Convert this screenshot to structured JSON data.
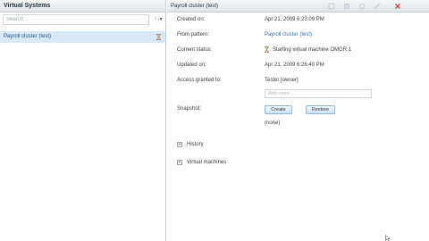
{
  "left_panel": {
    "title": "Virtual Systems",
    "search": {
      "placeholder": "Search...",
      "value": ""
    },
    "sort_label": "↑↓▾",
    "items": [
      {
        "label": "Payroll cluster (test)",
        "status_icon": "hourglass-icon"
      }
    ]
  },
  "detail": {
    "title": "Payroll cluster (test)",
    "rows": {
      "created_on": {
        "label": "Created on:",
        "value": "Apr 21, 2009 6:23:09 PM"
      },
      "from_pattern": {
        "label": "From pattern:",
        "value": "Payroll cluster (test)"
      },
      "current_status": {
        "label": "Current status:",
        "value": "Starting virtual machine OMGR 1"
      },
      "updated_on": {
        "label": "Updated on:",
        "value": "Apr 21, 2009 6:26:40 PM"
      },
      "access": {
        "label": "Access granted to:",
        "value": "Tester [owner]",
        "add_placeholder": "Add more..."
      },
      "snapshot": {
        "label": "Snapshot:",
        "create_label": "Create",
        "restore_label": "Restore",
        "value": "(none)"
      }
    },
    "sections": [
      {
        "label": "History",
        "expander": "+"
      },
      {
        "label": "Virtual machines",
        "expander": "+"
      }
    ]
  },
  "colors": {
    "link": "#2f6ea5",
    "selection": "#d8e8f7",
    "close": "#c62828"
  }
}
